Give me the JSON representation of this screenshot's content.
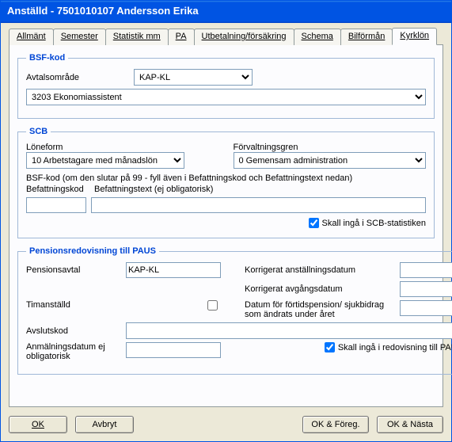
{
  "window": {
    "title": "Anställd - 7501010107  Andersson Erika"
  },
  "tabs": {
    "t0": "Allmänt",
    "t1": "Semester",
    "t2": "Statistik mm",
    "t3": "PA",
    "t4": "Utbetalning/försäkring",
    "t5": "Schema",
    "t6": "Bilförmån",
    "t7": "Kyrklön"
  },
  "bsf": {
    "legend": "BSF-kod",
    "avtalsomrade_label": "Avtalsområde",
    "avtalsomrade_value": "KAP-KL",
    "line2_value": "3203 Ekonomiassistent"
  },
  "scb": {
    "legend": "SCB",
    "loneform_label": "Löneform",
    "loneform_value": "10 Arbetstagare med månadslön",
    "forvaltningsgren_label": "Förvaltningsgren",
    "forvaltningsgren_value": "0 Gemensam administration",
    "bsf_hint": "BSF-kod (om den slutar på 99 - fyll även i Befattningskod och Befattningstext nedan)",
    "befattningskod_label": "Befattningskod",
    "befattningstext_label": "Befattningstext (ej obligatorisk)",
    "befattningskod_value": "",
    "befattningstext_value": "",
    "include_label": "Skall ingå i SCB-statistiken",
    "include_checked": true
  },
  "paus": {
    "legend": "Pensionsredovisning till PAUS",
    "pensionsavtal_label": "Pensionsavtal",
    "pensionsavtal_value": "KAP-KL",
    "korr_anst_label": "Korrigerat anställningsdatum",
    "korr_anst_value": "",
    "korr_avg_label": "Korrigerat avgångsdatum",
    "korr_avg_value": "",
    "timanstalld_label": "Timanställd",
    "timanstalld_checked": false,
    "fortid_label": "Datum för förtidspension/ sjukbidrag som ändrats under året",
    "fortid_value": "",
    "avslutskod_label": "Avslutskod",
    "avslutskod_value": "",
    "anmdatum_label": "Anmälningsdatum ej obligatorisk",
    "anmdatum_value": "",
    "include_label": "Skall ingå i redovisning till PAUS",
    "include_checked": true
  },
  "buttons": {
    "ok": "OK",
    "avbryt": "Avbryt",
    "okforeg": "OK & Föreg.",
    "oknasta": "OK & Nästa"
  }
}
